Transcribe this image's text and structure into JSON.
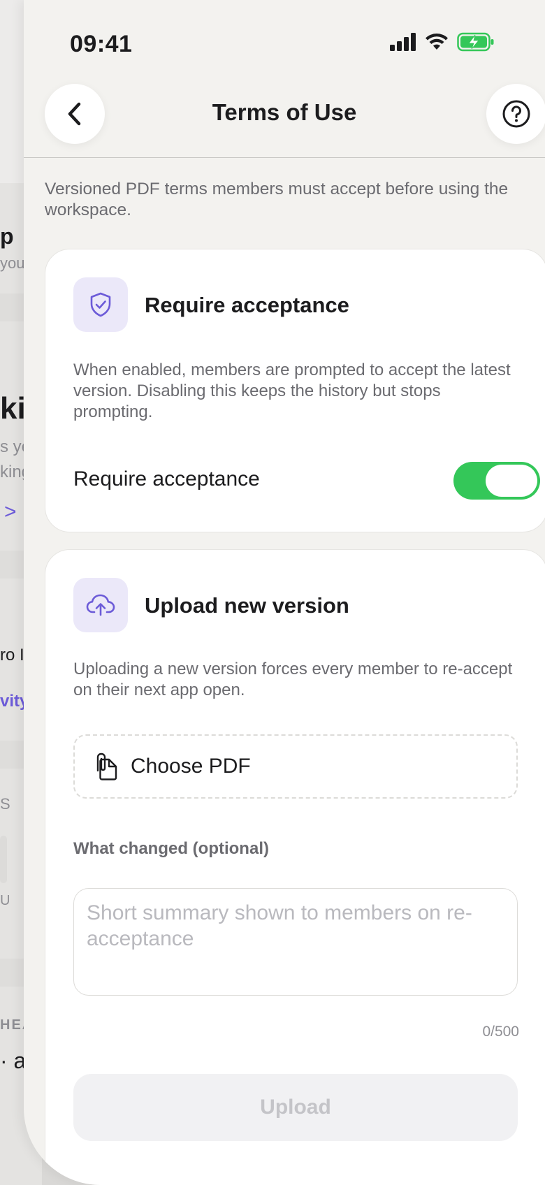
{
  "status_bar": {
    "time": "09:41"
  },
  "header": {
    "title": "Terms of Use"
  },
  "intro": "Versioned PDF terms members must accept before using the workspace.",
  "acceptance_card": {
    "title": "Require acceptance",
    "description": "When enabled, members are prompted to accept the latest version. Disabling this keeps the history but stops prompting.",
    "toggle_label": "Require acceptance",
    "toggle_on": true
  },
  "upload_card": {
    "title": "Upload new version",
    "description": "Uploading a new version forces every member to re-accept on their next app open.",
    "choose_label": "Choose PDF",
    "field_label": "What changed (optional)",
    "placeholder": "Short summary shown to members on re-acceptance",
    "counter": "0/500",
    "upload_label": "Upload"
  },
  "background": {
    "t1": "p",
    "t2": "your",
    "t3": "kin",
    "t4": "s ye",
    "t5": "king",
    "t6": ">",
    "t7": "ro I",
    "t8": "vity",
    "t9": "S",
    "t10": "U",
    "t11": "HEA",
    "t12": "· a"
  },
  "colors": {
    "accent": "#6c5bd8",
    "toggle_on": "#34c759",
    "icon_bg": "#ebe8f9"
  }
}
